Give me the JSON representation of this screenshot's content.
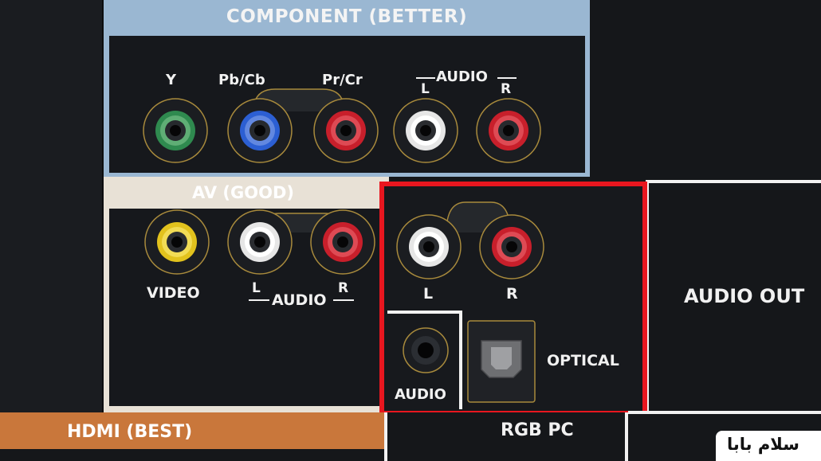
{
  "component": {
    "header": "COMPONENT (BETTER)",
    "labels": {
      "y": "Y",
      "pb": "Pb/Cb",
      "pr": "Pr/Cr",
      "audio": "AUDIO",
      "l": "L",
      "r": "R"
    }
  },
  "av": {
    "header": "AV (GOOD)",
    "labels": {
      "video": "VIDEO",
      "audio": "AUDIO",
      "l": "L",
      "r": "R"
    }
  },
  "audio_out": {
    "title": "AUDIO OUT",
    "labels": {
      "l": "L",
      "r": "R",
      "optical": "OPTICAL",
      "audio": "AUDIO"
    }
  },
  "hdmi": {
    "header": "HDMI (BEST)"
  },
  "rgb_pc": {
    "header": "RGB PC"
  },
  "watermark": {
    "text": "سلام بابا"
  },
  "colors": {
    "panel_bg": "#16181c",
    "component_frame": "#9ab7d2",
    "av_frame": "#e8e1d6",
    "hdmi_bar": "#c9773b",
    "highlight": "#e8161f",
    "jack_green": "#2f8a4f",
    "jack_blue": "#2c5fd3",
    "jack_red": "#c81f2b",
    "jack_white": "#eeeeee",
    "jack_yellow": "#e2c21d"
  },
  "icons": [
    "rca-jack-icon",
    "mini-jack-icon",
    "optical-port-icon"
  ]
}
